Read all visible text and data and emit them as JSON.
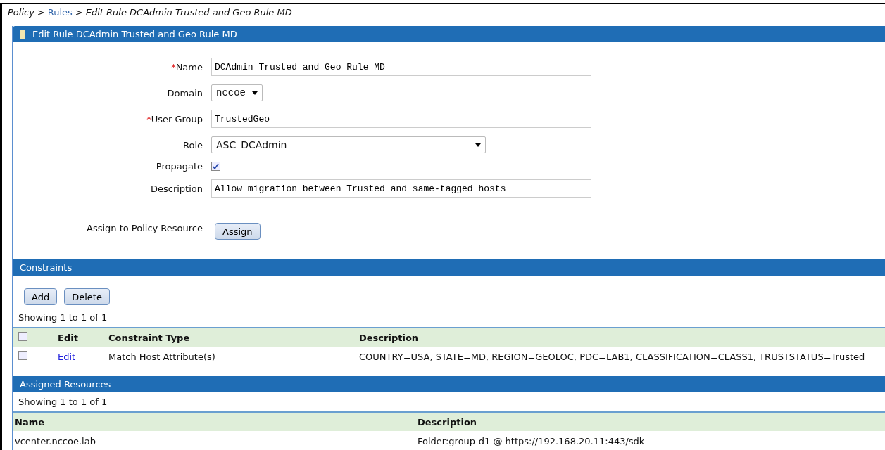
{
  "breadcrumb": [
    {
      "text": "Policy",
      "kind": "text"
    },
    {
      "text": ">",
      "kind": "separator"
    },
    {
      "text": "Rules",
      "kind": "link"
    },
    {
      "text": ">",
      "kind": "separator"
    },
    {
      "text": "Edit Rule DCAdmin Trusted and Geo Rule MD",
      "kind": "text"
    }
  ],
  "panel_title": "Edit Rule DCAdmin Trusted and Geo Rule MD",
  "form": [
    {
      "kind": "text",
      "required_mark": "*",
      "label": "Name",
      "value": "DCAdmin Trusted and Geo Rule MD"
    },
    {
      "kind": "short-select",
      "label": "Domain",
      "value": "nccoe"
    },
    {
      "kind": "text",
      "required_mark": "*",
      "label": "User Group",
      "value": "TrustedGeo"
    },
    {
      "kind": "select",
      "label": "Role",
      "value": "ASC_DCAdmin"
    },
    {
      "kind": "checkbox",
      "label": "Propagate",
      "checked": true
    },
    {
      "kind": "text",
      "label": "Description",
      "value": "Allow migration between Trusted and same-tagged hosts"
    },
    {
      "kind": "button",
      "label": "Assign to Policy Resource",
      "button": "Assign"
    }
  ],
  "constraints": {
    "title": "Constraints",
    "buttons": [
      "Add",
      "Delete"
    ],
    "showing": "Showing 1 to 1 of 1",
    "columns": [
      "Edit",
      "Constraint Type",
      "Description"
    ],
    "header_checked": false,
    "rows": [
      {
        "checked": false,
        "edit": "Edit",
        "type": "Match Host Attribute(s)",
        "description": "COUNTRY=USA, STATE=MD, REGION=GEOLOC, PDC=LAB1, CLASSIFICATION=CLASS1, TRUSTSTATUS=Trusted"
      }
    ]
  },
  "assigned": {
    "title": "Assigned Resources",
    "showing": "Showing 1 to 1 of 1",
    "columns": [
      "Name",
      "Description"
    ],
    "rows": [
      {
        "name": "vcenter.nccoe.lab",
        "description": "Folder:group-d1 @ https://192.168.20.11:443/sdk"
      }
    ]
  }
}
